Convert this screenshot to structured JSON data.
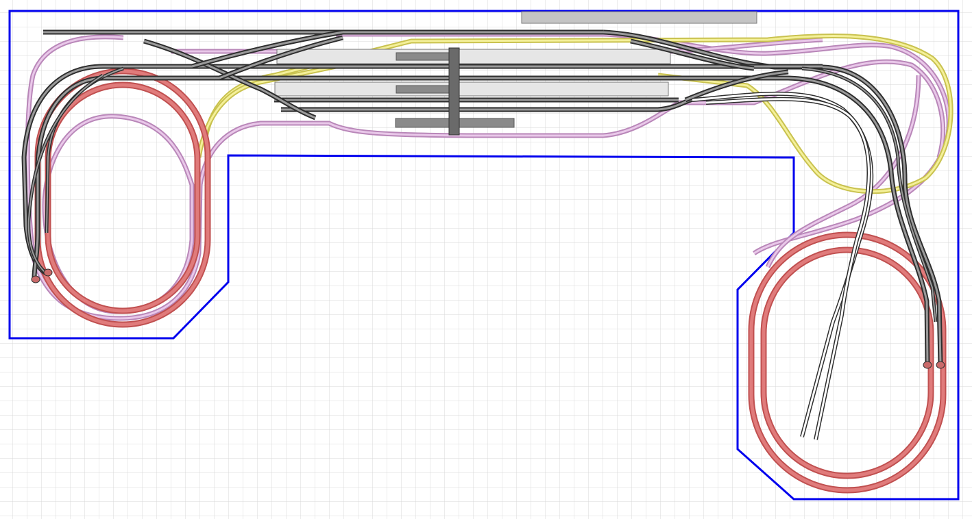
{
  "canvas": {
    "background": "#ffffff",
    "grid_color": "#d8d8d8",
    "grid_visible": true
  },
  "colors": {
    "baseboard_outline": "#0000ee",
    "track_red": "#d96363",
    "track_pink": "#cc99cc",
    "track_yellow": "#e8e070",
    "track_dark": "#3a3a3a",
    "track_white": "#ffffff",
    "platform": "#e6e6e6",
    "platform_dark": "#7a7a7a",
    "footbridge": "#6a6a6a"
  },
  "track_groups": [
    "red-helix-left",
    "red-helix-right",
    "pink-loop",
    "yellow-loop",
    "dark-station-lines",
    "white-branch"
  ]
}
